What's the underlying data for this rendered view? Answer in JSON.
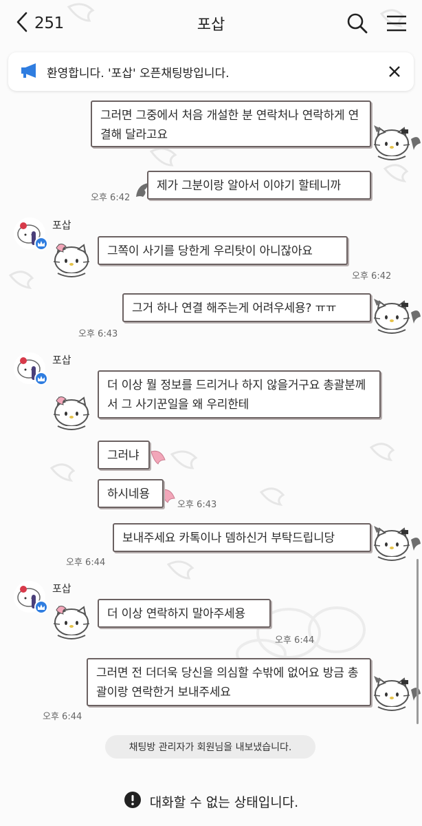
{
  "header": {
    "back_count": "251",
    "room_title": "포삽"
  },
  "notice": {
    "text": "환영합니다. '포삽' 오픈채팅방입니다."
  },
  "messages": {
    "m1": {
      "text": "그러면 그중에서 처음 개설한 분 연락처나 연락하게 연결해 달라고요"
    },
    "m2": {
      "text": "제가 그분이랑 알아서 이야기 할테니까",
      "time": "오후 6:42"
    },
    "m3_sender": "포삽",
    "m3": {
      "text": "그쪽이 사기를 당한게 우리탓이 아니잖아요",
      "time": "오후 6:42"
    },
    "m4": {
      "text": "그거 하나 연결 해주는게 어려우세용? ㅠㅠ",
      "time": "오후 6:43"
    },
    "m5_sender": "포삽",
    "m5": {
      "text": "더 이상 뭘 정보를 드리거나 하지 않을거구요 총괄분께서 그 사기꾼일을 왜 우리한테"
    },
    "m6": {
      "text": "그러냐"
    },
    "m7": {
      "text": "하시네용",
      "time": "오후 6:43"
    },
    "m8": {
      "text": "보내주세요 카톡이나 뎀하신거 부탁드립니당",
      "time": "오후 6:44"
    },
    "m9_sender": "포삽",
    "m9": {
      "text": "더 이상 연락하지 말아주세용",
      "time": "오후 6:44"
    },
    "m10": {
      "text": "그러면 전 더더욱 당신을 의심할 수밖에 없어요 방금 총괄이랑 연락한거 보내주세요",
      "time": "오후 6:44"
    }
  },
  "system": {
    "kicked": "채팅방 관리자가 회원님을 내보냈습니다."
  },
  "status": {
    "text": "대화할 수 없는 상태입니다."
  },
  "icons": {
    "back": "chevron-left-icon",
    "search": "search-icon",
    "menu": "hamburger-menu-icon",
    "megaphone": "megaphone-icon",
    "close": "close-icon",
    "warning": "exclamation-circle-icon",
    "crown": "crown-icon"
  },
  "colors": {
    "bubble_border": "#6b6161",
    "megaphone_blue": "#2f7de0",
    "crown_blue": "#2f7de0",
    "pink_wing": "#f2a6b9",
    "gray_wing": "#6e6e6e"
  }
}
